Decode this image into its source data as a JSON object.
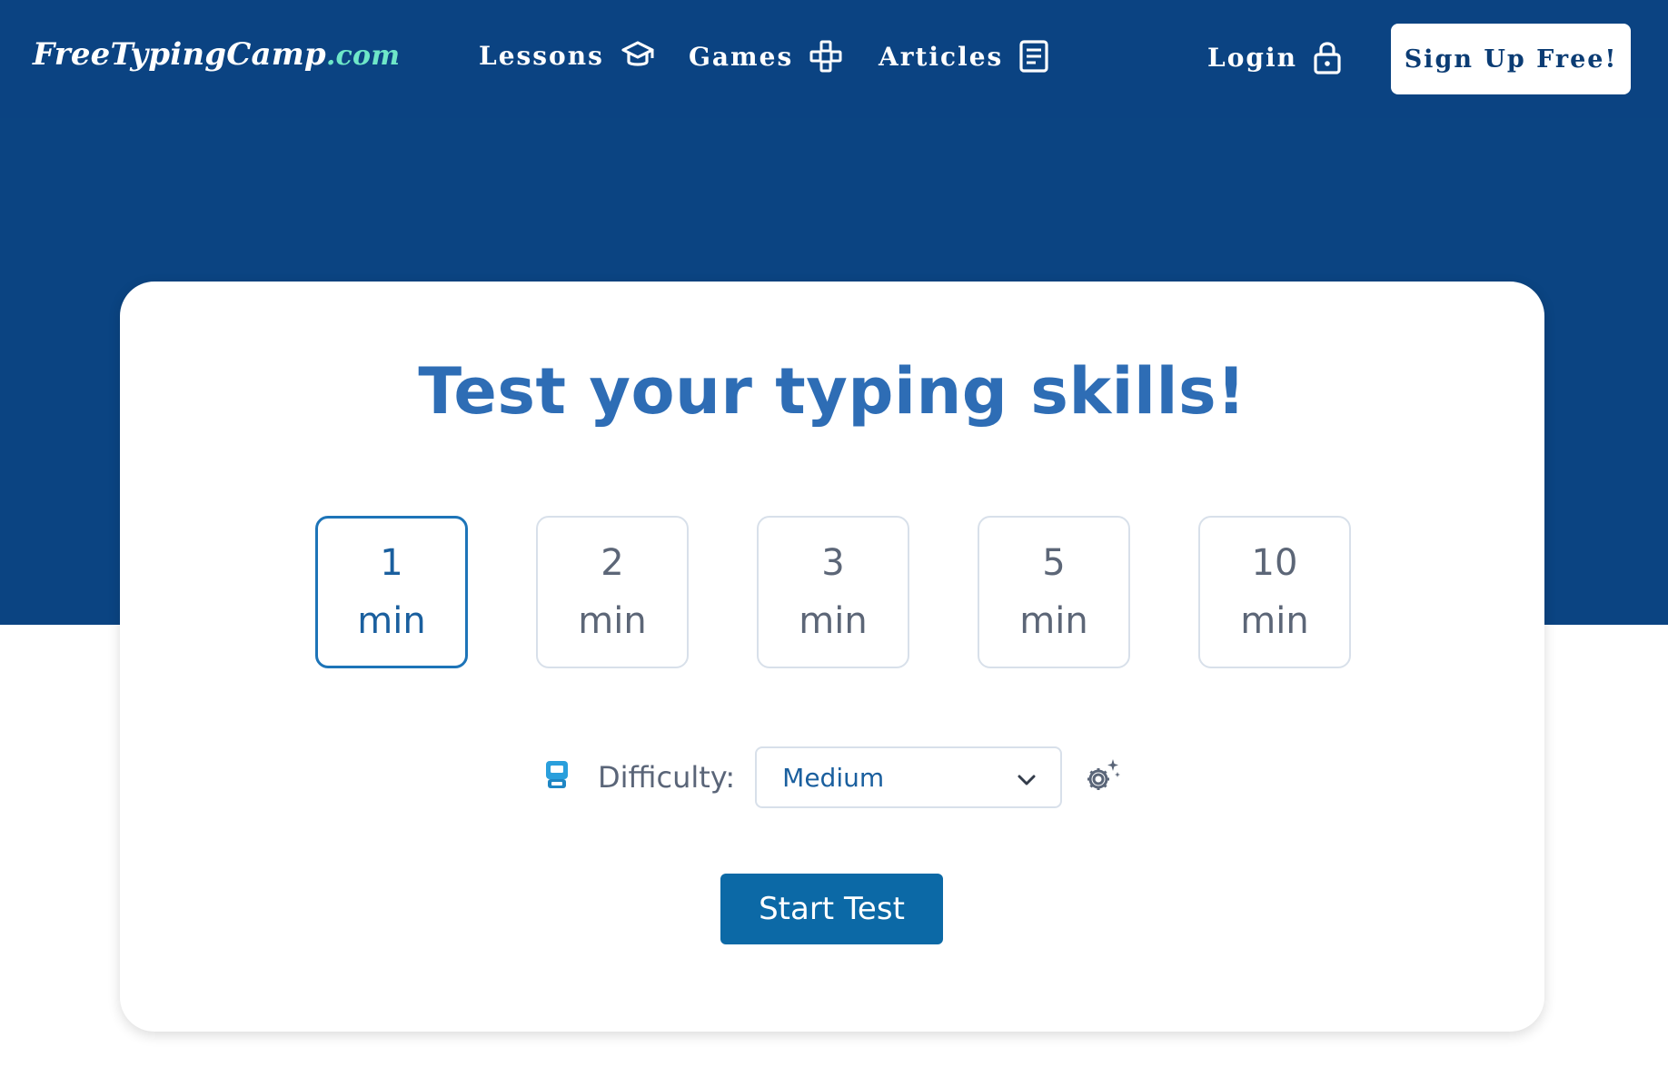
{
  "header": {
    "logo": {
      "main": "FreeTypingCamp",
      "tld": ".com"
    },
    "nav": {
      "lessons": {
        "label": "Lessons",
        "icon": "graduation-cap-icon"
      },
      "games": {
        "label": "Games",
        "icon": "gamepad-icon"
      },
      "articles": {
        "label": "Articles",
        "icon": "document-icon"
      },
      "login": {
        "label": "Login",
        "icon": "lock-icon"
      }
    },
    "signup_label": "Sign Up Free!"
  },
  "test": {
    "title": "Test your typing skills!",
    "durations": [
      {
        "value": "1",
        "unit": "min",
        "selected": true
      },
      {
        "value": "2",
        "unit": "min",
        "selected": false
      },
      {
        "value": "3",
        "unit": "min",
        "selected": false
      },
      {
        "value": "5",
        "unit": "min",
        "selected": false
      },
      {
        "value": "10",
        "unit": "min",
        "selected": false
      }
    ],
    "difficulty": {
      "label": "Difficulty:",
      "selected": "Medium",
      "icon": "keyboard-key-icon",
      "settings_icon": "gear-sparkle-icon"
    },
    "start_label": "Start Test"
  },
  "colors": {
    "header_bg": "#0b4382",
    "title": "#2e6db5",
    "primary_button": "#0c69a6",
    "selected_border": "#1d74b8",
    "logo_tld": "#6ee7c8"
  }
}
